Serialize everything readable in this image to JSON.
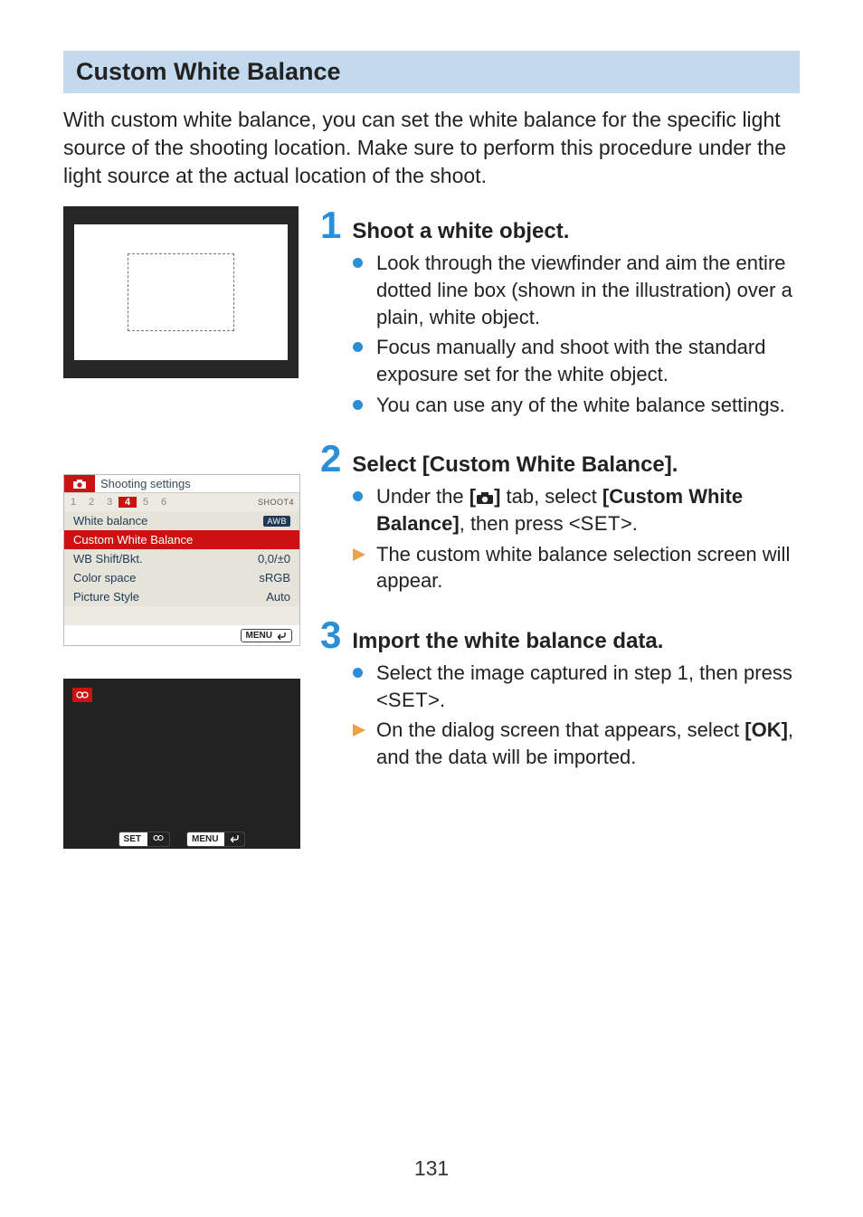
{
  "page_number": "131",
  "section_title": "Custom White Balance",
  "intro": "With custom white balance, you can set the white balance for the specific light source of the shooting location. Make sure to perform this procedure under the light source at the actual location of the shoot.",
  "menu": {
    "header_title": "Shooting settings",
    "tabs": [
      "1",
      "2",
      "3",
      "4",
      "5",
      "6"
    ],
    "active_tab": "4",
    "shoot_label": "SHOOT4",
    "rows": {
      "wb": {
        "label": "White balance",
        "value": "AWB"
      },
      "cwb": {
        "label": "Custom White Balance"
      },
      "shift": {
        "label": "WB Shift/Bkt.",
        "value": "0,0/±0"
      },
      "cspace": {
        "label": "Color space",
        "value": "sRGB"
      },
      "pstyle": {
        "label": "Picture Style",
        "value": "Auto"
      }
    },
    "footer_menu": "MENU"
  },
  "screenshot3": {
    "badge": "⤹",
    "set": "SET",
    "menu": "MENU"
  },
  "steps": [
    {
      "num": "1",
      "title": "Shoot a white object.",
      "items": [
        {
          "type": "dot",
          "text": "Look through the viewfinder and aim the entire dotted line box (shown in the illustration) over a plain, white object."
        },
        {
          "type": "dot",
          "text": "Focus manually and shoot with the standard exposure set for the white object."
        },
        {
          "type": "dot",
          "text": "You can use any of the white balance settings."
        }
      ]
    },
    {
      "num": "2",
      "title": "Select [Custom White Balance].",
      "items": [
        {
          "type": "dot",
          "pre": "Under the ",
          "boldA": "[",
          "boldB": "]",
          "mid": " tab, select ",
          "boldC": "[Custom White Balance]",
          "post": ", then press <",
          "set": "SET",
          "tail": ">."
        },
        {
          "type": "arrow",
          "text": "The custom white balance selection screen will appear."
        }
      ]
    },
    {
      "num": "3",
      "title": "Import the white balance data.",
      "items": [
        {
          "type": "dot",
          "pre": "Select the image captured in step 1, then press <",
          "set": "SET",
          "tail": ">."
        },
        {
          "type": "arrow",
          "pre": "On the dialog screen that appears, select ",
          "boldA": "[OK]",
          "post": ", and the data will be imported."
        }
      ]
    }
  ]
}
